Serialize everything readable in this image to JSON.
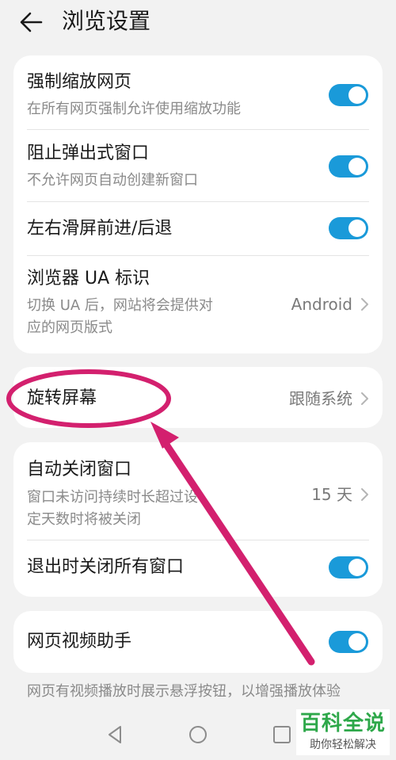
{
  "header": {
    "title": "浏览设置"
  },
  "group1": {
    "force_zoom": {
      "title": "强制缩放网页",
      "subtitle": "在所有网页强制允许使用缩放功能",
      "enabled": true
    },
    "block_popups": {
      "title": "阻止弹出式窗口",
      "subtitle": "不允许网页自动创建新窗口",
      "enabled": true
    },
    "swipe_nav": {
      "title": "左右滑屏前进/后退",
      "enabled": true
    },
    "ua": {
      "title": "浏览器 UA 标识",
      "subtitle_line1": "切换 UA 后，网站将会提供对",
      "subtitle_line2": "应的网页版式",
      "value": "Android"
    }
  },
  "group2": {
    "rotate": {
      "title": "旋转屏幕",
      "value": "跟随系统"
    }
  },
  "group3": {
    "auto_close": {
      "title": "自动关闭窗口",
      "subtitle_line1": "窗口未访问持续时长超过设",
      "subtitle_line2": "定天数时将被关闭",
      "value": "15 天"
    },
    "close_on_exit": {
      "title": "退出时关闭所有窗口",
      "enabled": true
    }
  },
  "group4": {
    "video_helper": {
      "title": "网页视频助手",
      "enabled": true
    }
  },
  "footer_note": "网页有视频播放时展示悬浮按钮，以增强播放体验",
  "watermark": {
    "main": "百科全说",
    "sub": "助你轻松解决"
  },
  "colors": {
    "accent": "#1a9ad9",
    "annotation": "#d3206e",
    "background": "#f2f2f2",
    "card": "#ffffff"
  },
  "icons": {
    "back": "arrow-left",
    "chevron": "chevron-right",
    "nav_back": "triangle-left",
    "nav_home": "circle",
    "nav_recent": "square"
  }
}
